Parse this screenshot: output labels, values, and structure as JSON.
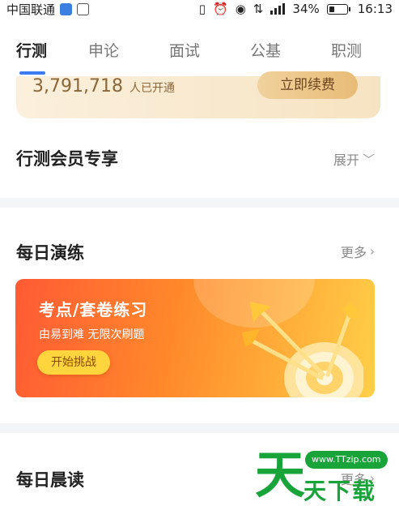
{
  "status_bar": {
    "carrier": "中国联通",
    "battery": "34%",
    "battery_level": 0.34,
    "time": "16:13"
  },
  "tabs": [
    {
      "label": "行测",
      "active": true
    },
    {
      "label": "申论",
      "active": false
    },
    {
      "label": "面试",
      "active": false
    },
    {
      "label": "公基",
      "active": false
    },
    {
      "label": "职测",
      "active": false
    }
  ],
  "renew": {
    "count": "3,791,718",
    "count_suffix": "人已开通",
    "button": "立即续费"
  },
  "member_section": {
    "title": "行测会员专享",
    "action": "展开"
  },
  "daily_practice": {
    "title": "每日演练",
    "action": "更多",
    "card_title": "考点/套卷练习",
    "card_subtitle": "由易到难  无限次刷题",
    "card_button": "开始挑战"
  },
  "morning_read": {
    "title": "每日晨读",
    "action": "更多"
  },
  "watermark": {
    "big_char": "天",
    "url": "www.TTzip.com",
    "text": "天下载"
  },
  "colors": {
    "tab_accent": "#3b7cf3",
    "card_gradient_start": "#ff5a34",
    "card_gradient_end": "#ffcf48",
    "watermark_green": "#19a43a"
  },
  "icons": [
    "vibrate-icon",
    "alarm-icon",
    "eye-icon",
    "data-signal-icon",
    "signal-bars-icon",
    "battery-icon",
    "chevron-down-icon",
    "chevron-right-icon",
    "target-arrows-icon"
  ]
}
